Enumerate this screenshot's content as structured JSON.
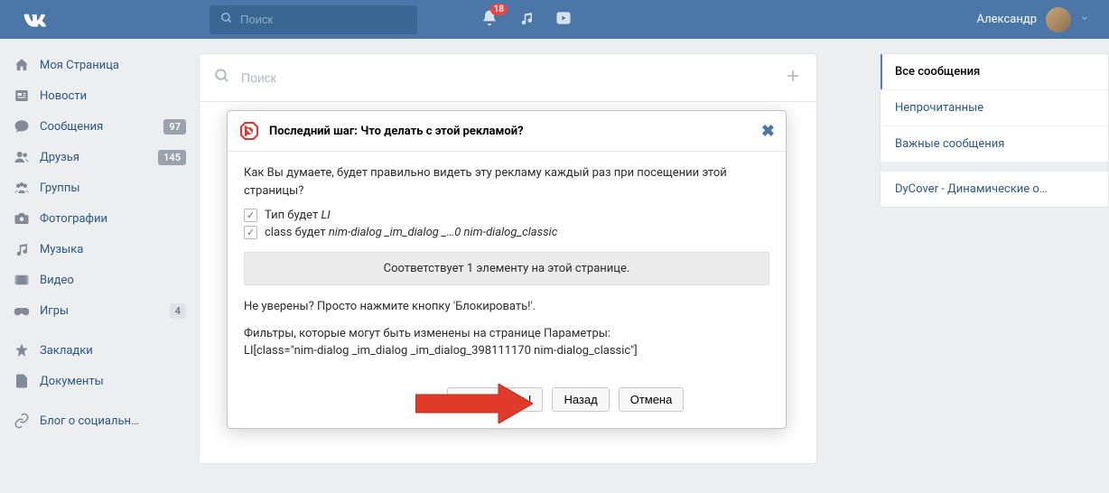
{
  "header": {
    "search_placeholder": "Поиск",
    "notification_count": "18",
    "username": "Александр"
  },
  "nav": {
    "items": [
      {
        "label": "Моя Страница",
        "icon": "home"
      },
      {
        "label": "Новости",
        "icon": "news"
      },
      {
        "label": "Сообщения",
        "icon": "messages",
        "badge": "97"
      },
      {
        "label": "Друзья",
        "icon": "friends",
        "badge": "145"
      },
      {
        "label": "Группы",
        "icon": "groups"
      },
      {
        "label": "Фотографии",
        "icon": "photos"
      },
      {
        "label": "Музыка",
        "icon": "music"
      },
      {
        "label": "Видео",
        "icon": "video"
      },
      {
        "label": "Игры",
        "icon": "games",
        "badge": "4",
        "light": true
      }
    ],
    "secondary": [
      {
        "label": "Закладки",
        "icon": "bookmarks"
      },
      {
        "label": "Документы",
        "icon": "docs"
      }
    ],
    "tertiary": [
      {
        "label": "Блог о социальн…",
        "icon": "link"
      }
    ]
  },
  "main_search_placeholder": "Поиск",
  "dialog": {
    "title": "Последний шаг: Что делать с этой рекламой?",
    "question": "Как Вы думаете, будет правильно видеть эту рекламу каждый раз при посещении этой страницы?",
    "check1_prefix": "Тип будет ",
    "check1_em": "LI",
    "check2_prefix": "class будет ",
    "check2_em": "nim-dialog _im_dialog _…0 nim-dialog_classic",
    "match_text": "Соответствует 1 элементу на этой странице.",
    "unsure_text": "Не уверены? Просто нажмите кнопку 'Блокировать!'.",
    "filters_label": "Фильтры, которые могут быть изменены на странице Параметры:",
    "filters_value": "LI[class=\"nim-dialog _im_dialog _im_dialog_398111170 nim-dialog_classic\"]",
    "btn_block": "Блокировать!",
    "btn_back": "Назад",
    "btn_cancel": "Отмена"
  },
  "right": {
    "items": [
      {
        "label": "Все сообщения",
        "active": true
      },
      {
        "label": "Непрочитанные"
      },
      {
        "label": "Важные сообщения"
      },
      {
        "label": "DyCover - Динамические о…"
      }
    ]
  }
}
